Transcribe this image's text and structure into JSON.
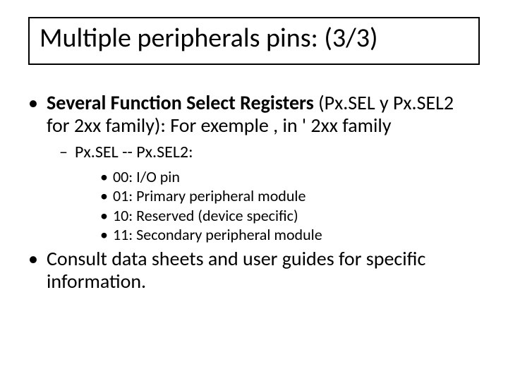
{
  "title": "Multiple peripherals pins:  (3/3)",
  "bullets": {
    "b1_bold": "Several Function Select Registers",
    "b1_rest": " (Px.SEL y Px.SEL2 for 2xx family):  For exemple , in ' 2xx family",
    "sub1": "Px.SEL  -- Px.SEL2:",
    "codes": [
      "00:   I/O  pin",
      "01:   Primary peripheral module",
      "10:  Reserved (device specific)",
      "11:  Secondary peripheral module"
    ],
    "b2": "Consult data sheets and user guides for specific information."
  }
}
